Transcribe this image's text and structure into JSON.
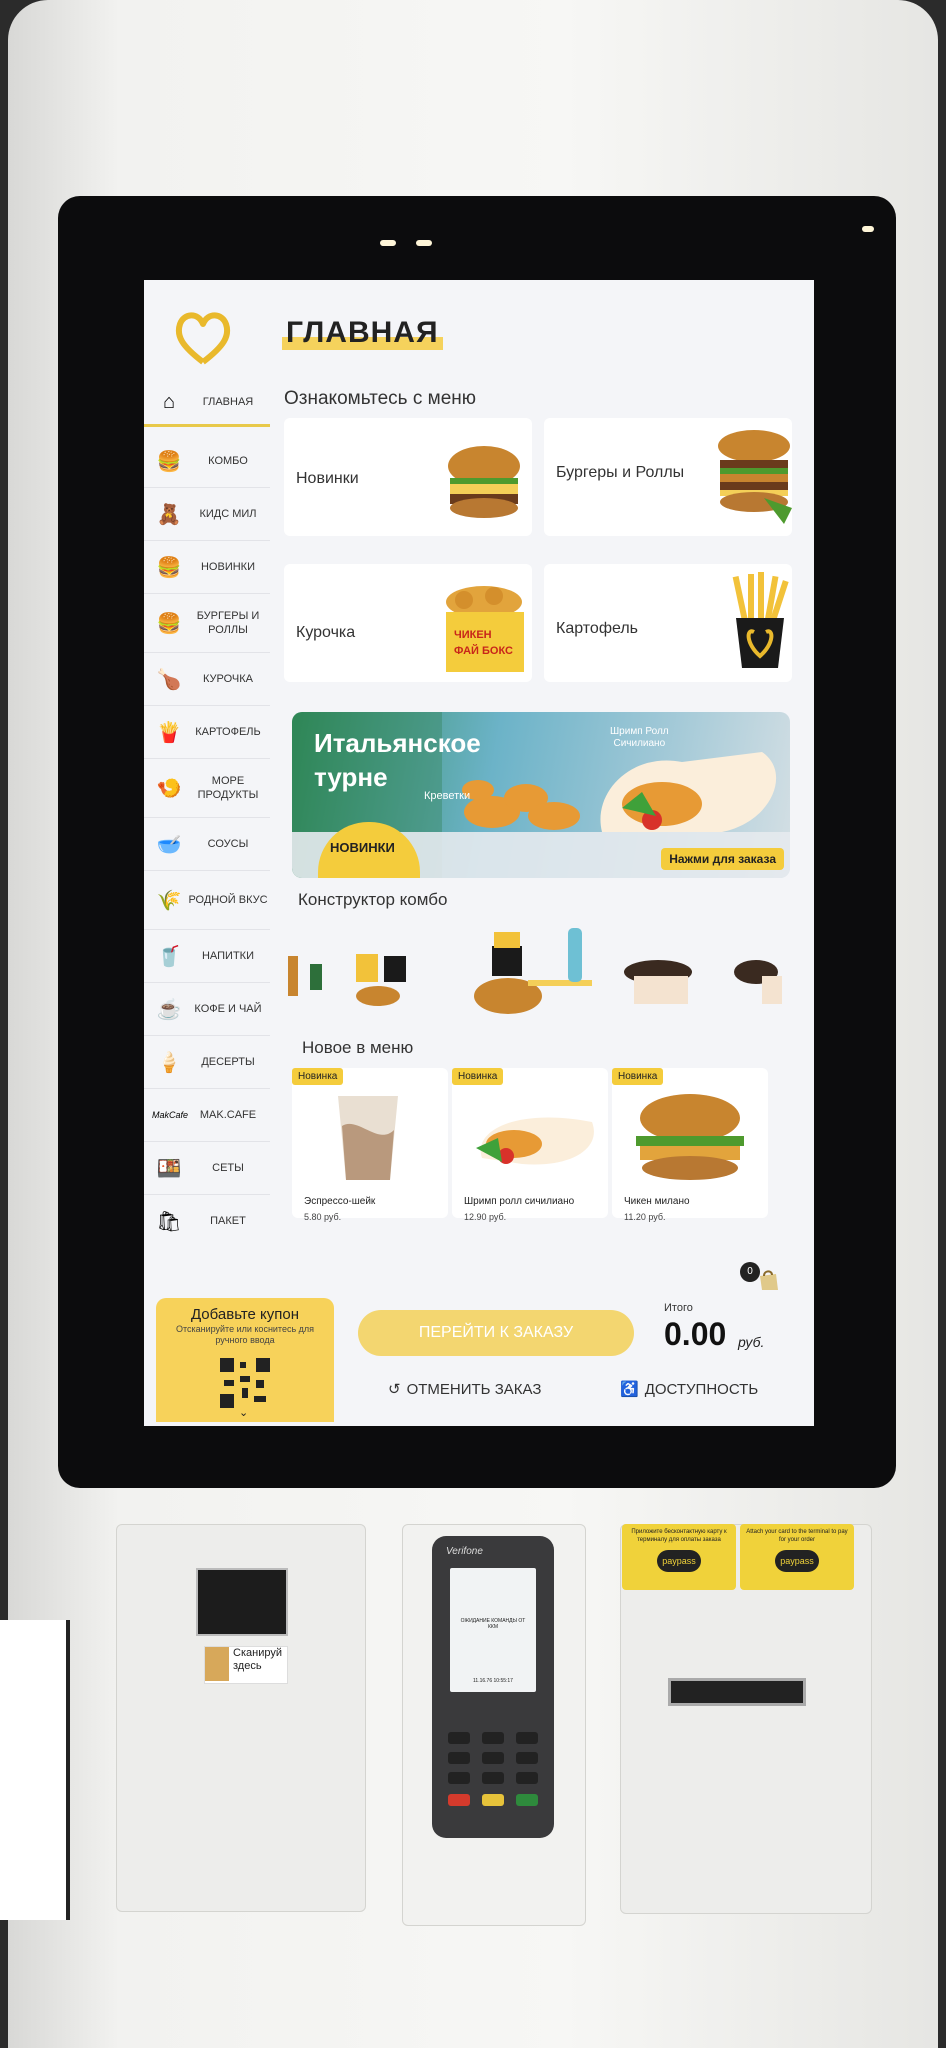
{
  "header": {
    "title": "ГЛАВНАЯ"
  },
  "sidebar": {
    "items": [
      {
        "label": "ГЛАВНАЯ",
        "icon": "home-icon",
        "active": true
      },
      {
        "label": "КОМБО",
        "icon": "combo-icon"
      },
      {
        "label": "КИДС МИЛ",
        "icon": "kids-meal-icon"
      },
      {
        "label": "НОВИНКИ",
        "icon": "burger-icon"
      },
      {
        "label": "БУРГЕРЫ И РОЛЛЫ",
        "icon": "burger-roll-icon"
      },
      {
        "label": "КУРОЧКА",
        "icon": "chicken-icon"
      },
      {
        "label": "КАРТОФЕЛЬ",
        "icon": "fries-icon"
      },
      {
        "label": "МОРЕ ПРОДУКТЫ",
        "icon": "seafood-icon"
      },
      {
        "label": "СОУСЫ",
        "icon": "sauce-icon"
      },
      {
        "label": "РОДНОЙ ВКУС",
        "icon": "rodnoy-vkus-icon"
      },
      {
        "label": "НАПИТКИ",
        "icon": "drink-icon"
      },
      {
        "label": "КОФЕ И ЧАЙ",
        "icon": "coffee-icon"
      },
      {
        "label": "ДЕСЕРТЫ",
        "icon": "dessert-icon"
      },
      {
        "label": "MAK.CAFE",
        "icon": "makcafe-icon"
      },
      {
        "label": "СЕТЫ",
        "icon": "set-icon"
      },
      {
        "label": "ПАКЕТ",
        "icon": "bag-icon"
      }
    ]
  },
  "menu_intro": {
    "title": "Ознакомьтесь с меню"
  },
  "categories": [
    {
      "label": "Новинки"
    },
    {
      "label": "Бургеры и Роллы"
    },
    {
      "label": "Курочка"
    },
    {
      "label": "Картофель"
    }
  ],
  "banner": {
    "line1": "Итальянское",
    "line2": "турне",
    "shrimp": "Креветки",
    "roll": "Шримп Ролл\nСичилиано",
    "badge": "НОВИНКИ",
    "cta": "Нажми для заказа",
    "box_text": "ЧИКЕН\nФАЙ БОКС"
  },
  "combo": {
    "title": "Конструктор комбо"
  },
  "new_items": {
    "title": "Новое в меню",
    "items": [
      {
        "badge": "Новинка",
        "name": "Эспрессо-шейк",
        "price": "5.80 руб."
      },
      {
        "badge": "Новинка",
        "name": "Шримп ролл сичилиано",
        "price": "12.90 руб."
      },
      {
        "badge": "Новинка",
        "name": "Чикен милано",
        "price": "11.20 руб."
      }
    ]
  },
  "bottom": {
    "coupon_title": "Добавьте купон",
    "coupon_sub": "Отсканируйте или коснитесь для ручного ввода",
    "checkout": "ПЕРЕЙТИ К ЗАКАЗУ",
    "total_label": "Итого",
    "total_value": "0.00",
    "currency": "руб.",
    "cart_count": "0",
    "cancel": "ОТМЕНИТЬ ЗАКАЗ",
    "accessibility": "ДОСТУПНОСТЬ"
  },
  "hardware": {
    "scan_label": "Сканируй здесь",
    "terminal_brand": "Verifone",
    "terminal_msg": "ОЖИДАНИЕ КОМАНДЫ ОТ ККМ",
    "terminal_time": "11.16.76  10:55:17",
    "sticker_left": "Приложите бесконтактную карту к терминалу для оплаты заказа",
    "sticker_right": "Attach your card to the terminal to pay for your order",
    "paypass": "paypass"
  },
  "colors": {
    "accent": "#f4cc3c",
    "checkout": "#f3d670",
    "screen_bg": "#f4f5f8"
  }
}
